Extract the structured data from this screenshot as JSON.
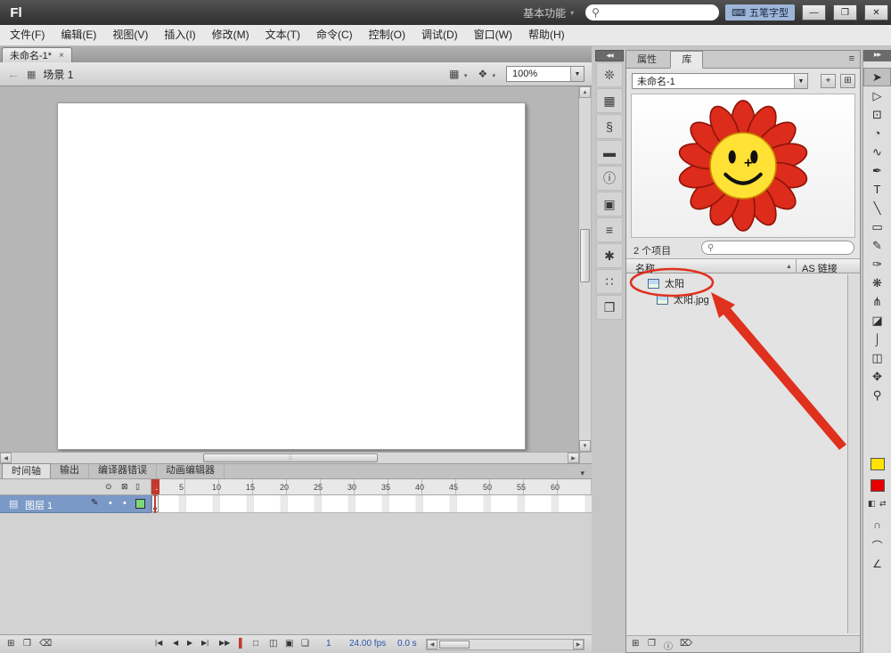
{
  "titlebar": {
    "logo": "Fl",
    "workspace": "基本功能",
    "workspace_caret": "▾",
    "search_icon": "⚲",
    "search_value": "",
    "ime_icon": "⌨",
    "ime_label": "五笔字型",
    "minimize": "—",
    "maximize": "❐",
    "close": "✕"
  },
  "menus": [
    "文件(F)",
    "编辑(E)",
    "视图(V)",
    "插入(I)",
    "修改(M)",
    "文本(T)",
    "命令(C)",
    "控制(O)",
    "调试(D)",
    "窗口(W)",
    "帮助(H)"
  ],
  "doc_tab": {
    "label": "未命名-1*",
    "close": "×"
  },
  "edit_bar": {
    "back_icon": "←",
    "scene_icon": "▦",
    "scene_label": "场景 1",
    "edit_scene_icon": "▦",
    "edit_symbol_icon": "❖",
    "icon_caret": "▾",
    "zoom_value": "100%",
    "zoom_caret": "▼"
  },
  "strip": {
    "collapse_icon": "◀◀",
    "icons": [
      "❊",
      "▦",
      "§",
      "▬",
      "ⓘ",
      "▣",
      "≡",
      "✱",
      "∷",
      "❒"
    ]
  },
  "panel": {
    "tabs": [
      "属性",
      "库"
    ],
    "menu_icon": "≡",
    "library": {
      "doc_select": "未命名-1",
      "select_caret": "▼",
      "pin_icon": "⌖",
      "new_icon": "⊞",
      "count_label": "2 个项目",
      "search_icon": "⚲",
      "col_name": "名称",
      "col_as": "AS 链接",
      "sort_icon": "▲",
      "items": [
        {
          "label": "太阳"
        },
        {
          "label": "太阳.jpg"
        }
      ],
      "footer_icons": [
        "⊞",
        "❒",
        "ⓘ",
        "⌦"
      ],
      "petal_color": "#dd2b1c",
      "face_color": "#ffe235"
    }
  },
  "toolbar": {
    "collapse_icon": "▶▶",
    "tools": [
      "➤",
      "▷",
      "⊡",
      "◔",
      "∿",
      "✒",
      "T",
      "╲",
      "▭",
      "✎",
      "✑",
      "❋",
      "⋔",
      "◪",
      "⌡",
      "◫",
      "✥",
      "⚲"
    ],
    "stroke_style": "background:#ffe400",
    "fill_style": "background:#e60000",
    "mini_icons": [
      "◧",
      "⇄"
    ],
    "option_icons": [
      "∩",
      "⌒",
      "∠"
    ]
  },
  "timeline": {
    "tabs": [
      "时间轴",
      "输出",
      "编译器错误",
      "动画编辑器"
    ],
    "menu_icon": "▾",
    "eye_icon": "⊙",
    "lock_icon": "⊠",
    "outline_icon": "▯",
    "layer": {
      "icon": "▤",
      "label": "图层 1",
      "pencil_icon": "✎",
      "dot1": "•",
      "dot2": "•"
    },
    "frames": [
      "1",
      "5",
      "10",
      "15",
      "20",
      "25",
      "30",
      "35",
      "40",
      "45",
      "50",
      "55",
      "60"
    ],
    "controls": {
      "new_layer_icon": "⊞",
      "folder_icon": "❒",
      "delete_icon": "⌫",
      "first": "|◀",
      "prev": "◀",
      "play": "▶",
      "next": "▶|",
      "last": "▶▶",
      "marker": "▌",
      "onion_icons": [
        "□",
        "◫",
        "▣",
        "❏"
      ],
      "frame_value": "1",
      "fps_value": "24.00 fps",
      "time_value": "0.0 s",
      "scroll_left": "◀",
      "scroll_right": "▶"
    }
  },
  "scroll": {
    "up": "▲",
    "down": "▼",
    "left": "◀",
    "right": "▶",
    "grip": "⁞⁞"
  }
}
